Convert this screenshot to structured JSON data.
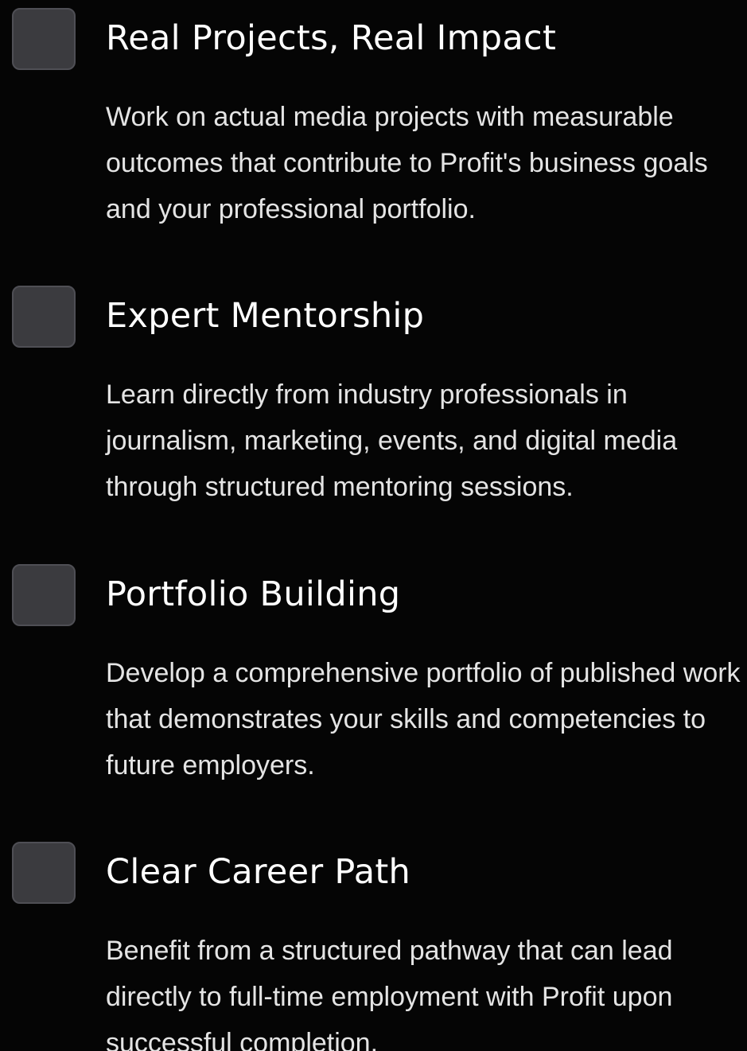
{
  "features": [
    {
      "icon": "feature-icon-placeholder",
      "title": "Real Projects, Real Impact",
      "description": "Work on actual media projects with measurable outcomes that contribute to Profit's business goals and your professional portfolio."
    },
    {
      "icon": "feature-icon-placeholder",
      "title": "Expert Mentorship",
      "description": "Learn directly from industry professionals in journalism, marketing, events, and digital media through structured mentoring sessions."
    },
    {
      "icon": "feature-icon-placeholder",
      "title": "Portfolio Building",
      "description": "Develop a comprehensive portfolio of published work that demonstrates your skills and competencies to future employers."
    },
    {
      "icon": "feature-icon-placeholder",
      "title": "Clear Career Path",
      "description": "Benefit from a structured pathway that can lead directly to full-time employment with Profit upon successful completion."
    }
  ],
  "colors": {
    "background": "#050505",
    "icon_fill": "#3b3b3f",
    "icon_border": "#4f4f55",
    "title": "#ffffff",
    "description": "#e4e4e4"
  }
}
